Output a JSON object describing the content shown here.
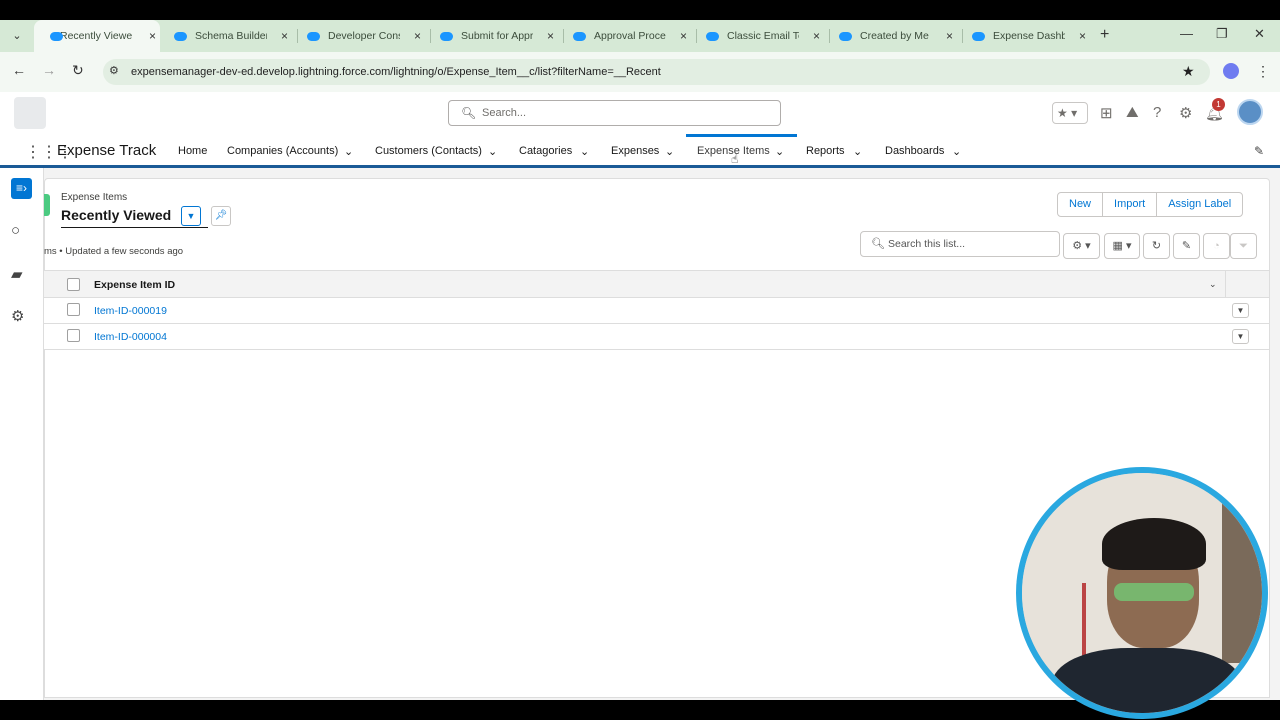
{
  "browser": {
    "tabs": [
      {
        "title": "Recently Viewed"
      },
      {
        "title": "Schema Builder |"
      },
      {
        "title": "Developer Cons"
      },
      {
        "title": "Submit for Appr"
      },
      {
        "title": "Approval Proces"
      },
      {
        "title": "Classic Email Te"
      },
      {
        "title": "Created by Me |"
      },
      {
        "title": "Expense Dashb"
      }
    ],
    "url": "expensemanager-dev-ed.develop.lightning.force.com/lightning/o/Expense_Item__c/list?filterName=__Recent",
    "icons": {
      "close": "×",
      "new_tab": "+",
      "back": "←",
      "forward": "→",
      "reload": "↻",
      "star": "★",
      "menu": "⋮",
      "minimize": "—",
      "restore": "❐",
      "close_window": "✕",
      "tab_list": "⌄"
    }
  },
  "header": {
    "search_placeholder": "Search...",
    "notification_count": "1"
  },
  "appnav": {
    "app_name": "Expense Track",
    "items": [
      {
        "label": "Home"
      },
      {
        "label": "Companies (Accounts)"
      },
      {
        "label": "Customers (Contacts)"
      },
      {
        "label": "Catagories"
      },
      {
        "label": "Expenses"
      },
      {
        "label": "Expense Items"
      },
      {
        "label": "Reports"
      },
      {
        "label": "Dashboards"
      }
    ],
    "active_index": 5
  },
  "listview": {
    "object_label": "Expense Items",
    "title": "Recently Viewed",
    "meta": "ms • Updated a few seconds ago",
    "buttons": {
      "new": "New",
      "import": "Import",
      "assign_label": "Assign Label"
    },
    "search_placeholder": "Search this list...",
    "column_header": "Expense Item ID",
    "rows": [
      {
        "id": "Item-ID-000019"
      },
      {
        "id": "Item-ID-000004"
      }
    ]
  },
  "colors": {
    "accent": "#0176d3",
    "brand_bar": "#1a5a96",
    "tab_bar": "#d6e9d6",
    "webcam_ring": "#2aa8e0"
  }
}
